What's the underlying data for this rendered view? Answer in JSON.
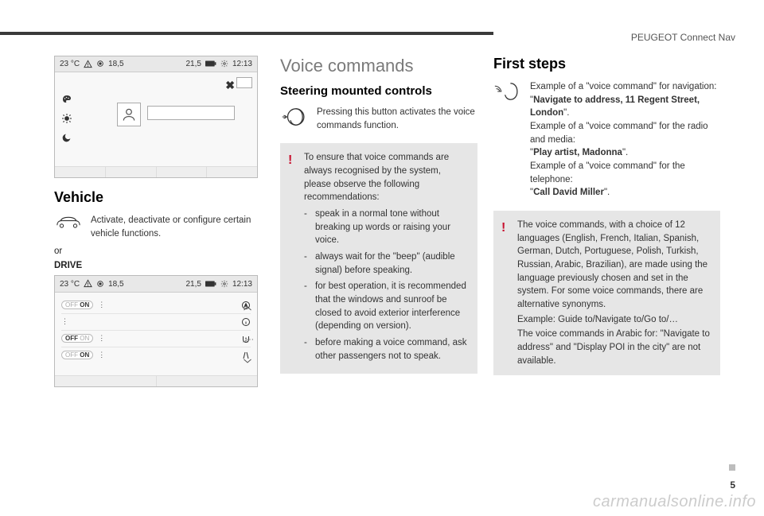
{
  "header": {
    "brand": "PEUGEOT Connect Nav"
  },
  "page_number": "5",
  "watermark": "carmanualsonline.info",
  "col1": {
    "screen1": {
      "status": {
        "temp": "23 °C",
        "val_a": "18,5",
        "val_b": "21,5",
        "time": "12:13"
      }
    },
    "vehicle_heading": "Vehicle",
    "vehicle_desc": "Activate, deactivate or configure certain vehicle functions.",
    "or_label": "or",
    "drive_label": "DRIVE",
    "screen2": {
      "status": {
        "temp": "23 °C",
        "val_a": "18,5",
        "val_b": "21,5",
        "time": "12:13"
      },
      "rows": [
        {
          "off": "OFF",
          "on": "ON"
        },
        {
          "off": "",
          "on": ""
        },
        {
          "off": "OFF",
          "on": "ON"
        },
        {
          "off": "OFF",
          "on": "ON"
        }
      ]
    }
  },
  "col2": {
    "title": "Voice commands",
    "subtitle": "Steering mounted controls",
    "button_desc": "Pressing this button activates the voice commands function.",
    "note": {
      "intro": "To ensure that voice commands are always recognised by the system, please observe the following recommendations:",
      "bullets": [
        "speak in a normal tone without breaking up words or raising your voice.",
        "always wait for the \"beep\" (audible signal) before speaking.",
        "for best operation, it is recommended that the windows and sunroof be closed to avoid exterior interference (depending on version).",
        "before making a voice command, ask other passengers not to speak."
      ]
    }
  },
  "col3": {
    "title": "First steps",
    "ex_nav_label": "Example of a \"voice command\" for navigation:",
    "ex_nav_cmd_pre": "\"",
    "ex_nav_cmd": "Navigate to address, 11 Regent Street, London",
    "ex_nav_cmd_post": "\".",
    "ex_media_label": "Example of a \"voice command\" for the radio and media:",
    "ex_media_cmd_pre": "\"",
    "ex_media_cmd": "Play artist, Madonna",
    "ex_media_cmd_post": "\".",
    "ex_phone_label": "Example of a \"voice command\" for the telephone:",
    "ex_phone_cmd_pre": "\"",
    "ex_phone_cmd": "Call David Miller",
    "ex_phone_cmd_post": "\".",
    "note2": "The voice commands, with a choice of 12 languages (English, French, Italian, Spanish, German, Dutch, Portuguese, Polish, Turkish, Russian, Arabic, Brazilian), are made using the language previously chosen and set in the system. For some voice commands, there are alternative synonyms.",
    "note2b": "Example: Guide to/Navigate to/Go to/…",
    "note2c": "The voice commands in Arabic for: \"Navigate to address\" and \"Display POI in the city\" are not available."
  }
}
